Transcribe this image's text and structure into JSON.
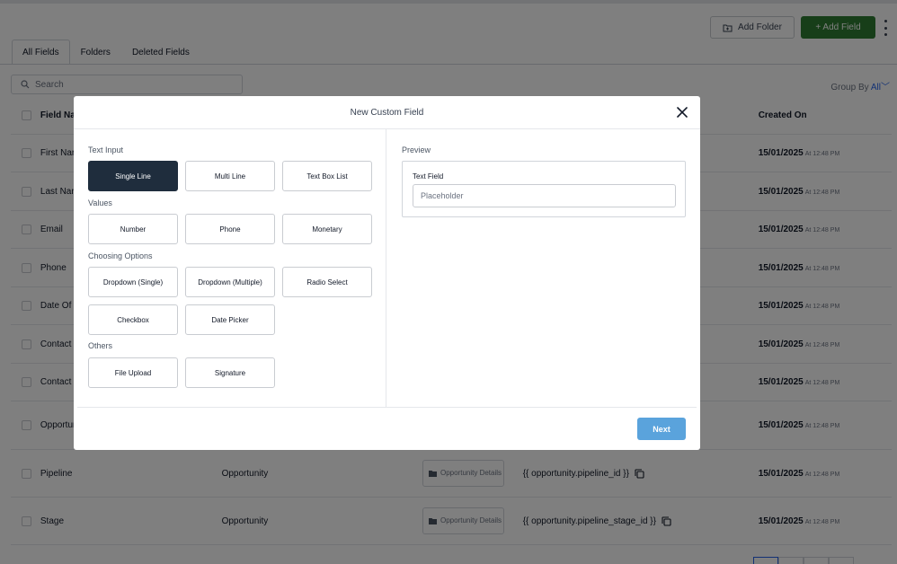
{
  "header": {
    "add_folder_label": "Add Folder",
    "add_field_label": "+ Add Field"
  },
  "tabs": [
    "All Fields",
    "Folders",
    "Deleted Fields"
  ],
  "search": {
    "placeholder": "Search"
  },
  "group_by": {
    "label": "Group By",
    "value": "All"
  },
  "table": {
    "columns": {
      "name": "Field Na",
      "created": "Created On"
    },
    "rows": [
      {
        "name": "First Nar",
        "created_date": "15/01/2025",
        "created_time": "At 12:48 PM"
      },
      {
        "name": "Last Nan",
        "created_date": "15/01/2025",
        "created_time": "At 12:48 PM"
      },
      {
        "name": "Email",
        "created_date": "15/01/2025",
        "created_time": "At 12:48 PM"
      },
      {
        "name": "Phone",
        "created_date": "15/01/2025",
        "created_time": "At 12:48 PM"
      },
      {
        "name": "Date Of E",
        "created_date": "15/01/2025",
        "created_time": "At 12:48 PM"
      },
      {
        "name": "Contact :",
        "created_date": "15/01/2025",
        "created_time": "At 12:48 PM"
      },
      {
        "name": "Contact ",
        "created_date": "15/01/2025",
        "created_time": "At 12:48 PM"
      },
      {
        "name": "Opportur",
        "created_date": "15/01/2025",
        "created_time": "At 12:48 PM"
      },
      {
        "name": "Pipeline",
        "object": "Opportunity",
        "folder": "Opportunity Details",
        "key": "{{ opportunity.pipeline_id }}",
        "created_date": "15/01/2025",
        "created_time": "At 12:48 PM"
      },
      {
        "name": "Stage",
        "object": "Opportunity",
        "folder": "Opportunity Details",
        "key": "{{ opportunity.pipeline_stage_id }}",
        "created_date": "15/01/2025",
        "created_time": "At 12:48 PM"
      }
    ]
  },
  "modal": {
    "title": "New Custom Field",
    "sections": {
      "text_input": "Text Input",
      "values": "Values",
      "choosing": "Choosing Options",
      "others": "Others"
    },
    "options": {
      "single_line": "Single Line",
      "multi_line": "Multi Line",
      "text_box_list": "Text Box List",
      "number": "Number",
      "phone": "Phone",
      "monetary": "Monetary",
      "dropdown_single": "Dropdown (Single)",
      "dropdown_multiple": "Dropdown (Multiple)",
      "radio_select": "Radio Select",
      "checkbox": "Checkbox",
      "date_picker": "Date Picker",
      "file_upload": "File Upload",
      "signature": "Signature"
    },
    "selected_option": "single_line",
    "preview": {
      "label": "Preview",
      "field_label": "Text Field",
      "placeholder": "Placeholder"
    },
    "next_label": "Next"
  },
  "colors": {
    "add_field_bg": "#2e7d32",
    "selected_option_bg": "#1f2d3d",
    "next_button_bg": "#5aa3dc",
    "link": "#2563eb"
  }
}
